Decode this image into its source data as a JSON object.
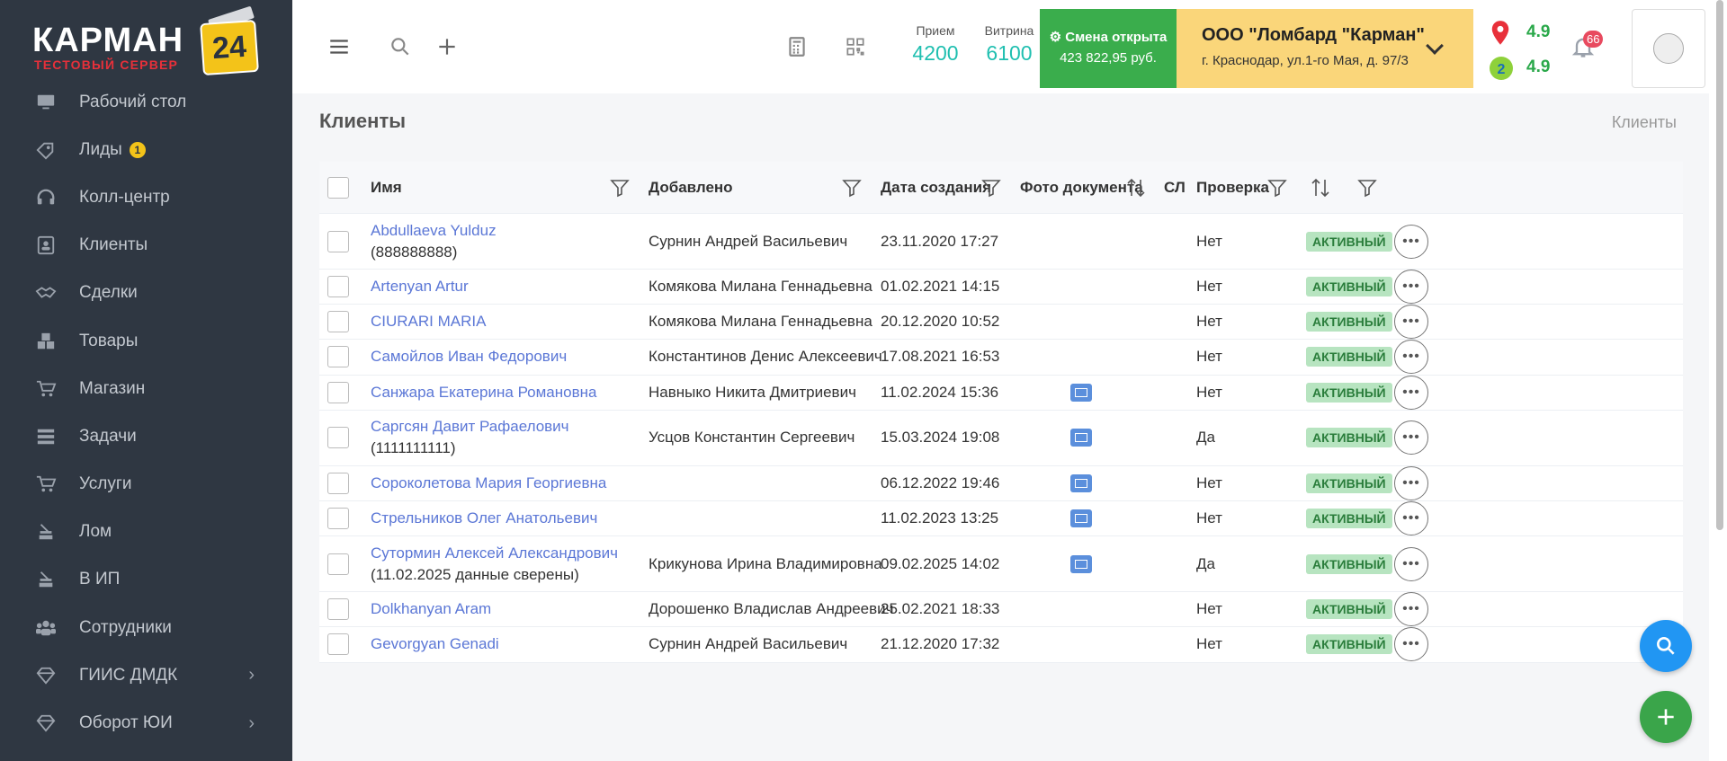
{
  "logo": {
    "brand": "КАРМАН",
    "badge": "24",
    "sub": "ТЕСТОВЫЙ СЕРВЕР"
  },
  "sidebar": {
    "items": [
      {
        "label": "Рабочий стол",
        "icon": "desktop-icon"
      },
      {
        "label": "Лиды",
        "icon": "tag-icon",
        "count": "1"
      },
      {
        "label": "Колл-центр",
        "icon": "headset-icon"
      },
      {
        "label": "Клиенты",
        "icon": "contact-card-icon"
      },
      {
        "label": "Сделки",
        "icon": "handshake-icon"
      },
      {
        "label": "Товары",
        "icon": "boxes-icon"
      },
      {
        "label": "Магазин",
        "icon": "cart-icon"
      },
      {
        "label": "Задачи",
        "icon": "tasks-icon"
      },
      {
        "label": "Услуги",
        "icon": "cart-icon"
      },
      {
        "label": "Лом",
        "icon": "stack-icon"
      },
      {
        "label": "В ИП",
        "icon": "stack-icon"
      },
      {
        "label": "Сотрудники",
        "icon": "users-icon"
      },
      {
        "label": "ГИИС ДМДК",
        "icon": "diamond-icon",
        "arrow": "›"
      },
      {
        "label": "Оборот ЮИ",
        "icon": "diamond-icon",
        "arrow": "›"
      }
    ]
  },
  "topbar": {
    "kpi_priem": {
      "title": "Прием",
      "value": "4200"
    },
    "kpi_vitrina": {
      "title": "Витрина",
      "value": "6100"
    },
    "shift": {
      "status": "Смена открыта",
      "amount": "423 822,95 руб."
    },
    "org": {
      "name": "ООО \"Ломбард \"Карман\"",
      "address": "г. Краснодар, ул.1-го Мая, д. 97/3"
    },
    "rating_map": "4.9",
    "rating_2gis": "4.9",
    "notifications": "66"
  },
  "page": {
    "title": "Клиенты",
    "breadcrumb": "Клиенты"
  },
  "table": {
    "headers": {
      "name": "Имя",
      "added": "Добавлено",
      "created": "Дата создания",
      "photo": "Фото документа",
      "sl": "СЛ",
      "check": "Проверка"
    },
    "rows": [
      {
        "name": "Abdullaeva Yulduz",
        "sub": "(888888888)",
        "added": "Сурнин Андрей Васильевич",
        "created": "23.11.2020 17:27",
        "photo": false,
        "check": "Нет",
        "status": "АКТИВНЫЙ"
      },
      {
        "name": "Artenyan Artur",
        "sub": "",
        "added": "Комякова Милана Геннадьевна",
        "created": "01.02.2021 14:15",
        "photo": false,
        "check": "Нет",
        "status": "АКТИВНЫЙ"
      },
      {
        "name": "CIURARI MARIA",
        "sub": "",
        "added": "Комякова Милана Геннадьевна",
        "created": "20.12.2020 10:52",
        "photo": false,
        "check": "Нет",
        "status": "АКТИВНЫЙ"
      },
      {
        "name": "Самойлов Иван Федорович",
        "sub": "",
        "added": "Константинов Денис Алексеевич",
        "created": "17.08.2021 16:53",
        "photo": false,
        "check": "Нет",
        "status": "АКТИВНЫЙ"
      },
      {
        "name": "Санжара Екатерина Романовна",
        "sub": "",
        "added": "Навныко Никита Дмитриевич",
        "created": "11.02.2024 15:36",
        "photo": true,
        "check": "Нет",
        "status": "АКТИВНЫЙ"
      },
      {
        "name": "Саргсян Давит Рафаелович",
        "sub": "(1111111111)",
        "added": "Усцов Константин Сергеевич",
        "created": "15.03.2024 19:08",
        "photo": true,
        "check": "Да",
        "status": "АКТИВНЫЙ"
      },
      {
        "name": "Сороколетова Мария Георгиевна",
        "sub": "",
        "added": "",
        "created": "06.12.2022 19:46",
        "photo": true,
        "check": "Нет",
        "status": "АКТИВНЫЙ"
      },
      {
        "name": "Стрельников Олег Анатольевич",
        "sub": "",
        "added": "",
        "created": "11.02.2023 13:25",
        "photo": true,
        "check": "Нет",
        "status": "АКТИВНЫЙ"
      },
      {
        "name": "Сутормин Алексей Александрович",
        "sub": "(11.02.2025 данные сверены)",
        "added": "Крикунова Ирина Владимировна",
        "created": "09.02.2025 14:02",
        "photo": true,
        "check": "Да",
        "status": "АКТИВНЫЙ"
      },
      {
        "name": "Dolkhanyan Aram",
        "sub": "",
        "added": "Дорошенко Владислав Андреевич",
        "created": "25.02.2021 18:33",
        "photo": false,
        "check": "Нет",
        "status": "АКТИВНЫЙ"
      },
      {
        "name": "Gevorgyan Genadi",
        "sub": "",
        "added": "Сурнин Андрей Васильевич",
        "created": "21.12.2020 17:32",
        "photo": false,
        "check": "Нет",
        "status": "АКТИВНЫЙ"
      }
    ]
  },
  "colors": {
    "sidebar_bg": "#2f3742",
    "link": "#5b77d6",
    "kpi": "#1fbfb0",
    "shift_bg": "#3aad4c",
    "org_bg": "#fad67a",
    "status_bg": "#b7e4c0",
    "fab_search": "#2196f3",
    "fab_add": "#3aa54a"
  }
}
